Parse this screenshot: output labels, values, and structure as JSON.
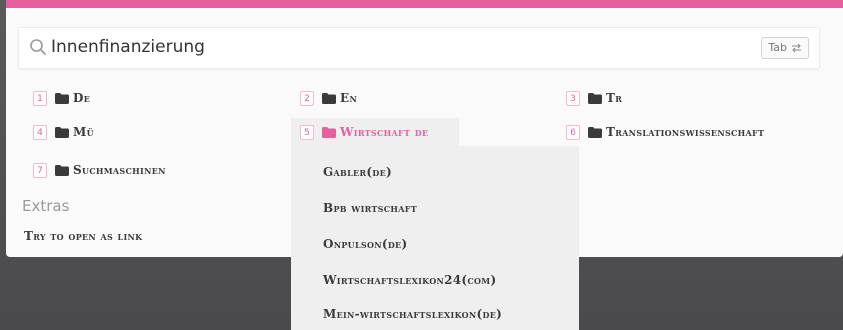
{
  "accent_color": "#e6609d",
  "search": {
    "value": "Innenfinanzierung",
    "icon": "search-icon",
    "tab_button_label": "Tab",
    "tab_icon": "tab-arrows-icon"
  },
  "folders": [
    {
      "num": "1",
      "label": "De",
      "icon": "folder-icon"
    },
    {
      "num": "2",
      "label": "En",
      "icon": "folder-icon"
    },
    {
      "num": "3",
      "label": "Tr",
      "icon": "folder-icon"
    },
    {
      "num": "4",
      "label": "Mü",
      "icon": "folder-icon"
    },
    {
      "num": "5",
      "label": "Wirtschaft de",
      "icon": "folder-icon",
      "active": true
    },
    {
      "num": "6",
      "label": "Translationswissenschaft",
      "icon": "folder-icon"
    },
    {
      "num": "7",
      "label": "Suchmaschinen",
      "icon": "folder-icon"
    }
  ],
  "submenu": [
    "Gabler(de)",
    "Bpb wirtschaft",
    "Onpulson(de)",
    "Wirtschaftslexikon24(com)",
    "Mein-wirtschaftslexikon(de)"
  ],
  "extras": {
    "title": "Extras",
    "items": [
      "Try to open as link"
    ]
  }
}
